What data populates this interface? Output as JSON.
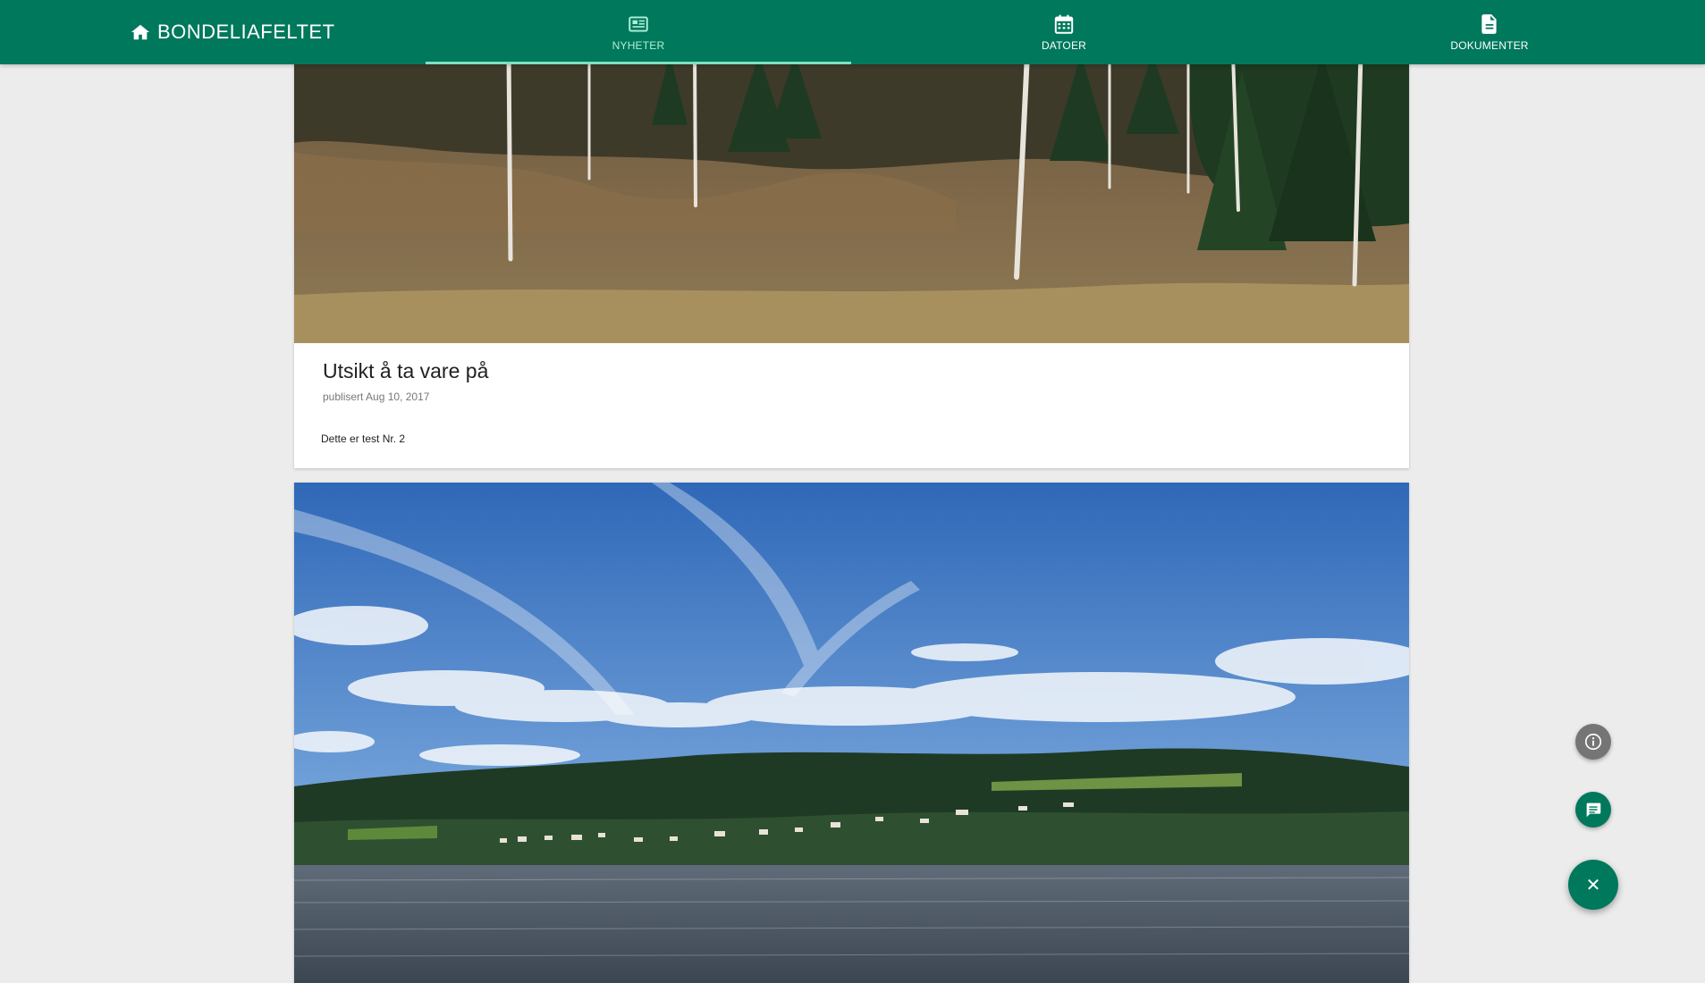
{
  "app": {
    "title": "BONDELIAFELTET",
    "brand_icon": "home-icon",
    "accent_color": "#00785c"
  },
  "tabs": [
    {
      "label": "NYHETER",
      "icon": "newspaper-icon",
      "active": true
    },
    {
      "label": "DATOER",
      "icon": "calendar-icon",
      "active": false
    },
    {
      "label": "DOKUMENTER",
      "icon": "document-icon",
      "active": false
    }
  ],
  "posts": [
    {
      "title": "Utsikt å ta vare på",
      "meta": "publisert Aug 10, 2017",
      "body": "Dette er test Nr. 2",
      "image": "forest-meadow-photo"
    },
    {
      "image": "lake-landscape-photo"
    }
  ],
  "fab": {
    "info_icon": "info-icon",
    "chat_icon": "chat-icon",
    "close_icon": "close-icon",
    "close_glyph": "✕"
  }
}
